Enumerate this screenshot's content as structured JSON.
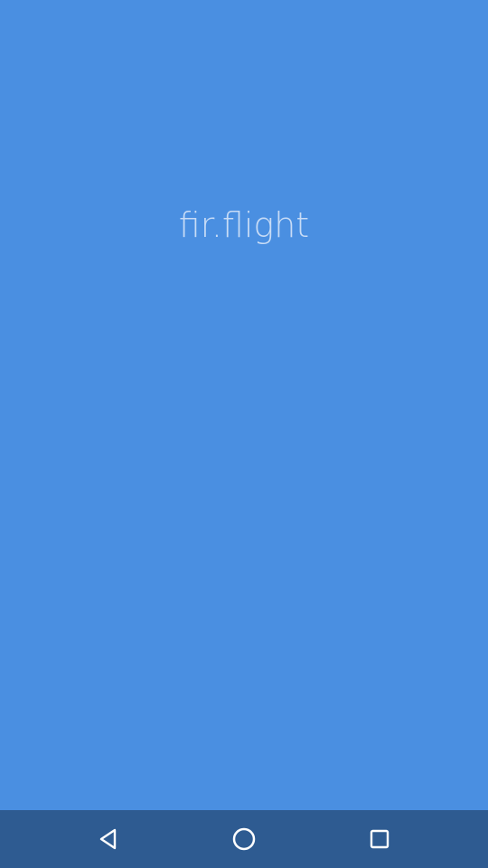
{
  "splash": {
    "title": "fir.flight"
  },
  "nav_bar": {
    "back_icon": "back-triangle-icon",
    "home_icon": "home-circle-icon",
    "recents_icon": "recents-square-icon"
  },
  "colors": {
    "background": "#4a8fe1",
    "nav_bar": "#2e5b91",
    "title_text": "#cfe1f8",
    "nav_icon": "#ffffff"
  }
}
